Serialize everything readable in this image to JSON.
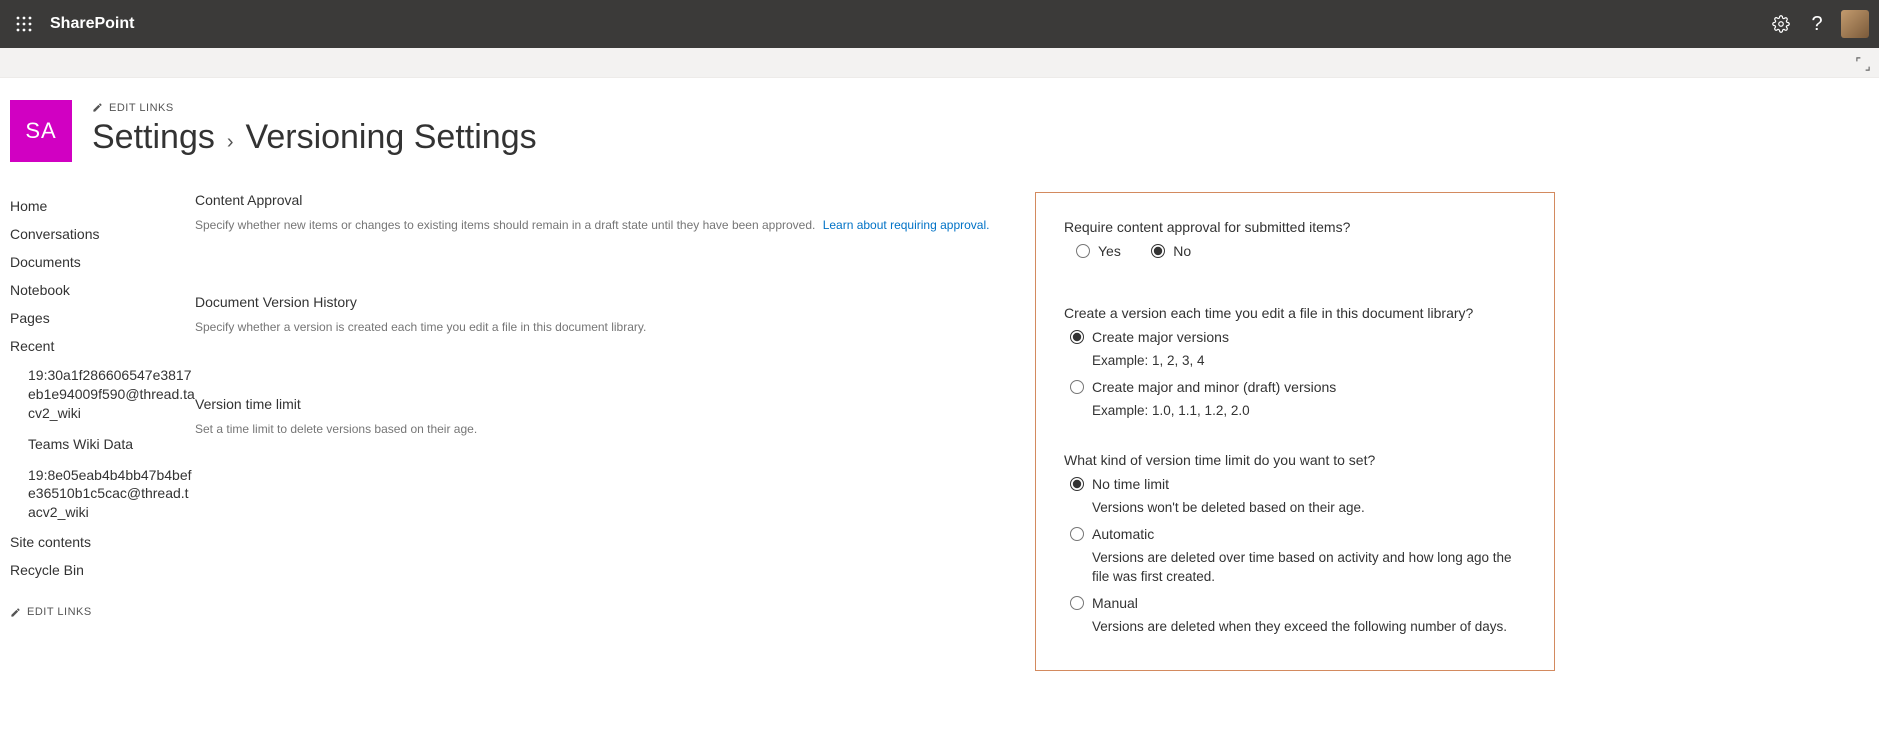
{
  "suitebar": {
    "brand": "SharePoint"
  },
  "site": {
    "tile": "SA",
    "editlinks": "EDIT LINKS"
  },
  "breadcrumb": {
    "parent": "Settings",
    "sep": "›",
    "current": "Versioning Settings"
  },
  "nav": {
    "items": [
      {
        "label": "Home"
      },
      {
        "label": "Conversations"
      },
      {
        "label": "Documents"
      },
      {
        "label": "Notebook"
      },
      {
        "label": "Pages"
      },
      {
        "label": "Recent"
      }
    ],
    "recent": [
      {
        "label": "19:30a1f286606547e3817eb1e94009f590@thread.tacv2_wiki"
      },
      {
        "label": "Teams Wiki Data"
      },
      {
        "label": "19:8e05eab4b4bb47b4befe36510b1c5cac@thread.tacv2_wiki"
      }
    ],
    "footer": [
      {
        "label": "Site contents"
      },
      {
        "label": "Recycle Bin"
      }
    ],
    "editlinks": "EDIT LINKS"
  },
  "sections": {
    "approval": {
      "title": "Content Approval",
      "desc": "Specify whether new items or changes to existing items should remain in a draft state until they have been approved.",
      "learn": "Learn about requiring approval."
    },
    "history": {
      "title": "Document Version History",
      "desc": "Specify whether a version is created each time you edit a file in this document library."
    },
    "timelimit": {
      "title": "Version time limit",
      "desc": "Set a time limit to delete versions based on their age."
    }
  },
  "options": {
    "approval": {
      "question": "Require content approval for submitted items?",
      "yes": "Yes",
      "no": "No",
      "selected": "no"
    },
    "history": {
      "question": "Create a version each time you edit a file in this document library?",
      "major": "Create major versions",
      "major_ex": "Example: 1, 2, 3, 4",
      "majorminor": "Create major and minor (draft) versions",
      "majorminor_ex": "Example: 1.0, 1.1, 1.2, 2.0",
      "selected": "major"
    },
    "timelimit": {
      "question": "What kind of version time limit do you want to set?",
      "none": "No time limit",
      "none_sub": "Versions won't be deleted based on their age.",
      "auto": "Automatic",
      "auto_sub": "Versions are deleted over time based on activity and how long ago the file was first created.",
      "manual": "Manual",
      "manual_sub": "Versions are deleted when they exceed the following number of days.",
      "selected": "none"
    }
  }
}
